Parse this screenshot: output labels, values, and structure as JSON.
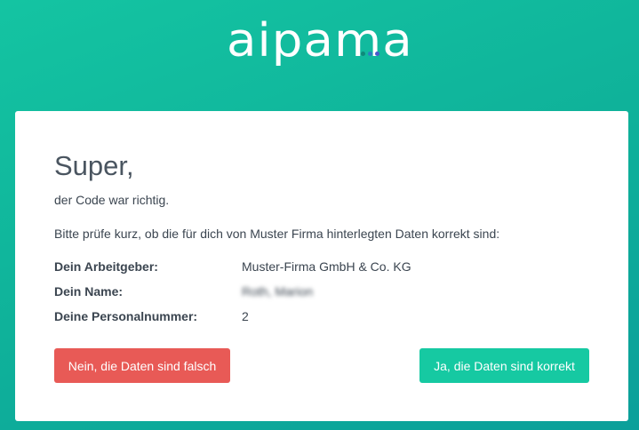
{
  "logo": {
    "text": "aipama",
    "dot_colors": [
      "#0f8a7a",
      "#2e7dbf",
      "#4a5acb"
    ]
  },
  "card": {
    "title": "Super,",
    "subtitle": "der Code war richtig.",
    "intro": "Bitte prüfe kurz, ob die für dich von Muster Firma hinterlegten Daten korrekt sind:",
    "fields": [
      {
        "label": "Dein Arbeitgeber:",
        "value": "Muster-Firma GmbH & Co. KG"
      },
      {
        "label": "Dein Name:",
        "value": "Roth, Marion"
      },
      {
        "label": "Deine Personalnummer:",
        "value": "2"
      }
    ],
    "reject_label": "Nein, die Daten sind falsch",
    "confirm_label": "Ja, die Daten sind korrekt"
  },
  "colors": {
    "background": "#13b99c",
    "reject": "#e85a56",
    "confirm": "#16c9a2"
  }
}
